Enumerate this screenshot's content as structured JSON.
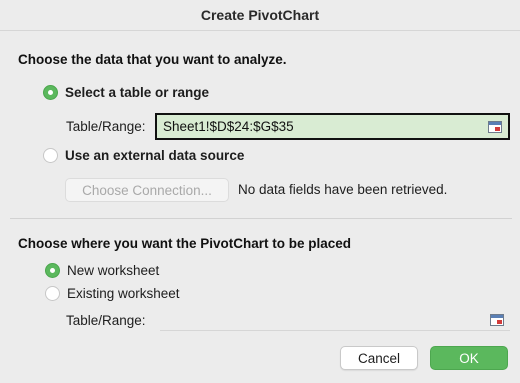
{
  "window": {
    "title": "Create PivotChart"
  },
  "source_section": {
    "heading": "Choose the data that you want to analyze.",
    "option_table": {
      "label": "Select a table or range",
      "checked": true
    },
    "range_label": "Table/Range:",
    "range_value": "Sheet1!$D$24:$G$35",
    "option_external": {
      "label": "Use an external data source",
      "checked": false
    },
    "choose_connection_label": "Choose Connection...",
    "no_fields_note": "No data fields have been retrieved."
  },
  "placement_section": {
    "heading": "Choose where you want the PivotChart to be placed",
    "option_new": {
      "label": "New worksheet",
      "checked": true
    },
    "option_existing": {
      "label": "Existing worksheet",
      "checked": false
    },
    "range_label": "Table/Range:",
    "range_value": ""
  },
  "buttons": {
    "cancel": "Cancel",
    "ok": "OK"
  },
  "colors": {
    "accent": "#5bb85d",
    "range_fill": "#d9ecd3"
  },
  "icons": {
    "range_picker": "range-picker-icon"
  }
}
